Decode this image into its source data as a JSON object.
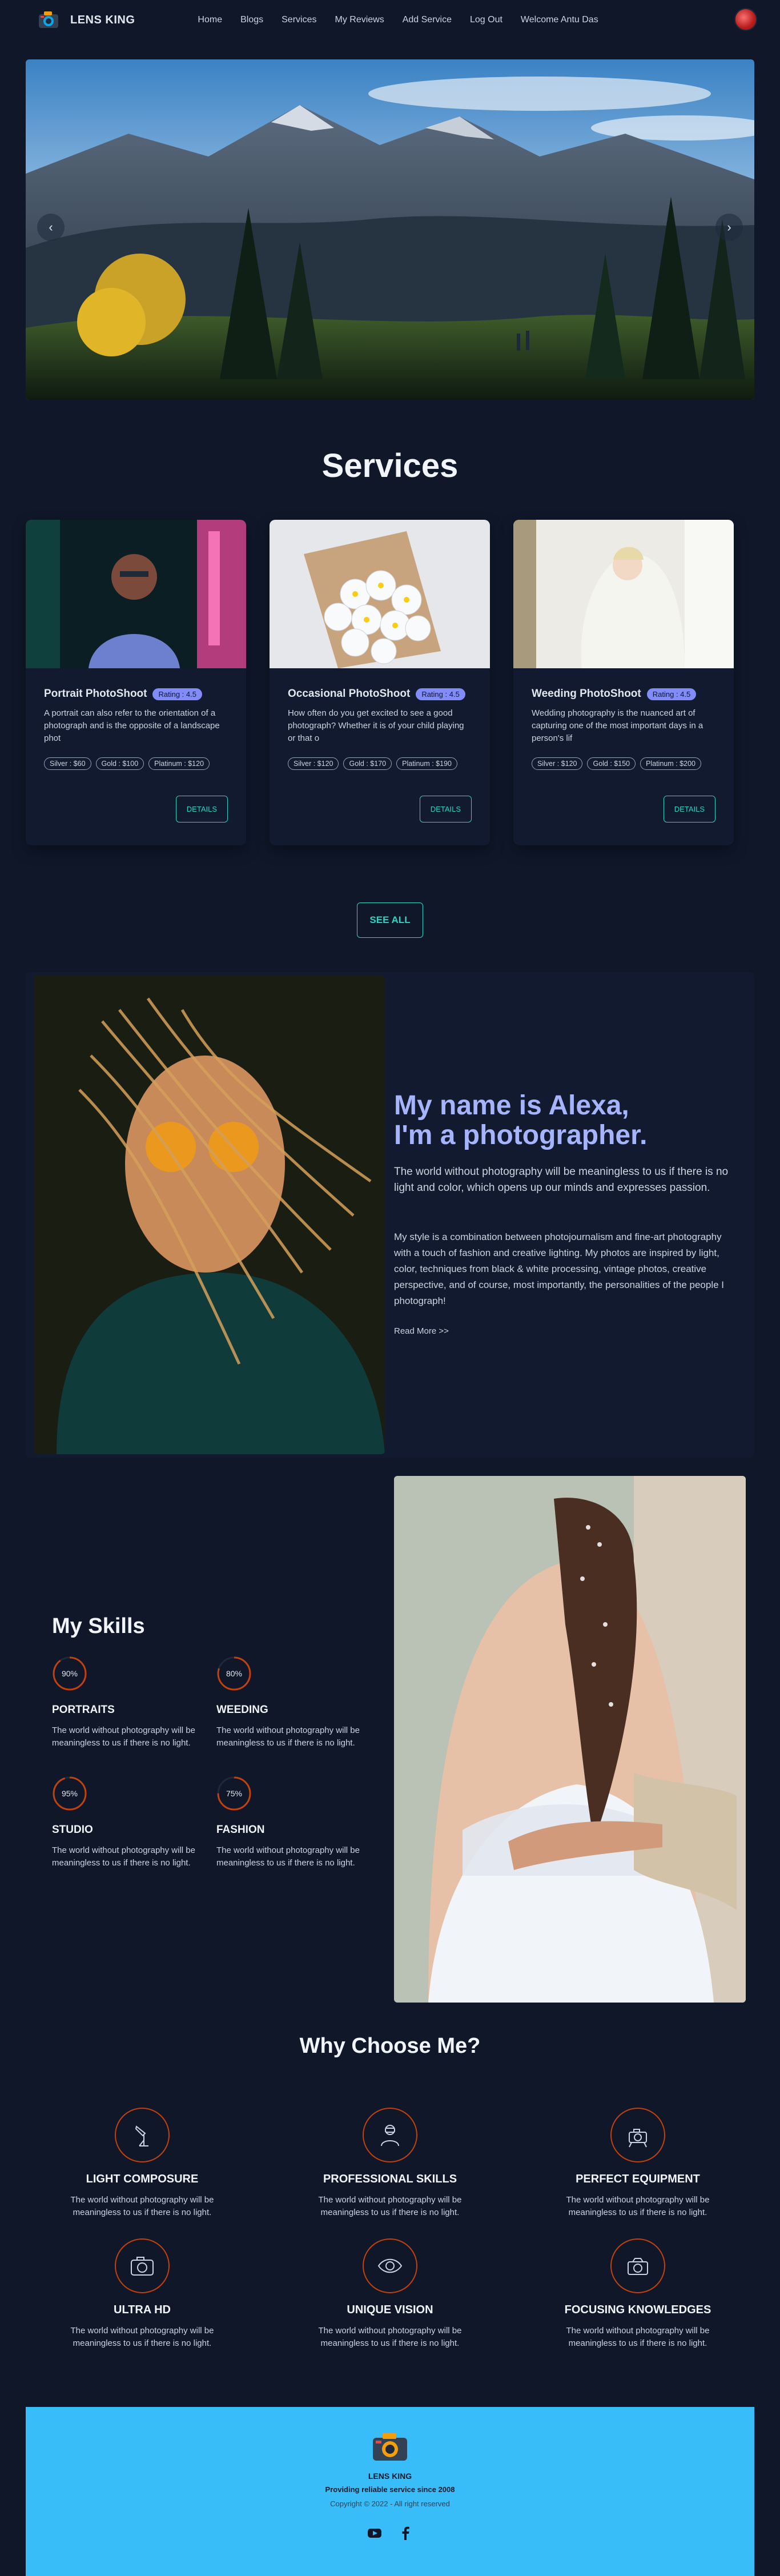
{
  "navbar": {
    "brand": "LENS KING",
    "items": [
      "Home",
      "Blogs",
      "Services",
      "My Reviews",
      "Add Service",
      "Log Out",
      "Welcome Antu Das"
    ]
  },
  "hero": {
    "prev_icon": "chevron-left-icon",
    "next_icon": "chevron-right-icon",
    "prev_label": "‹",
    "next_label": "›"
  },
  "services": {
    "title": "Services",
    "cards": [
      {
        "title": "Portrait PhotoShoot",
        "rating": "Rating : 4.5",
        "description": "A portrait can also refer to the orientation of a photograph and is the opposite of a landscape phot",
        "prices": [
          "Silver : $60",
          "Gold : $100",
          "Platinum : $120"
        ],
        "button": "DETAILS"
      },
      {
        "title": "Occasional PhotoShoot",
        "rating": "Rating : 4.5",
        "description": "How often do you get excited to see a good photograph? Whether it is of your child playing or that o",
        "prices": [
          "Silver : $120",
          "Gold : $170",
          "Platinum : $190"
        ],
        "button": "DETAILS"
      },
      {
        "title": "Weeding PhotoShoot",
        "rating": "Rating : 4.5",
        "description": "Wedding photography is the nuanced art of capturing one of the most important days in a person's lif",
        "prices": [
          "Silver : $120",
          "Gold : $150",
          "Platinum : $200"
        ],
        "button": "DETAILS"
      }
    ],
    "see_all": "SEE ALL"
  },
  "about": {
    "heading_line1": "My name is Alexa,",
    "heading_line2": "I'm a photographer.",
    "intro": "The world without photography will be meaningless to us if there is no light and color, which opens up our minds and expresses passion.",
    "body": "My style is a combination between photojournalism and fine-art photography with a touch of fashion and creative lighting. My photos are inspired by light, color, techniques from black & white processing, vintage photos, creative perspective, and of course, most importantly, the personalities of the people I photograph!",
    "read_more": "Read More >>"
  },
  "skills": {
    "title": "My Skills",
    "items": [
      {
        "percent": 90,
        "label": "90%",
        "name": "PORTRAITS",
        "desc": "The world without photography will be meaningless to us if there is no light."
      },
      {
        "percent": 80,
        "label": "80%",
        "name": "WEEDING",
        "desc": "The world without photography will be meaningless to us if there is no light."
      },
      {
        "percent": 95,
        "label": "95%",
        "name": "STUDIO",
        "desc": "The world without photography will be meaningless to us if there is no light."
      },
      {
        "percent": 75,
        "label": "75%",
        "name": "FASHION",
        "desc": "The world without photography will be meaningless to us if there is no light."
      }
    ]
  },
  "why": {
    "title": "Why Choose Me?",
    "items": [
      {
        "icon": "light-icon",
        "name": "LIGHT COMPOSURE",
        "desc": "The world without photography will be meaningless to us if there is no light."
      },
      {
        "icon": "photographer-icon",
        "name": "PROFESSIONAL SKILLS",
        "desc": "The world without photography will be meaningless to us if there is no light."
      },
      {
        "icon": "camera-equipment-icon",
        "name": "PERFECT EQUIPMENT",
        "desc": "The world without photography will be meaningless to us if there is no light."
      },
      {
        "icon": "camera-hd-icon",
        "name": "ULTRA HD",
        "desc": "The world without photography will be meaningless to us if there is no light."
      },
      {
        "icon": "eye-icon",
        "name": "UNIQUE VISION",
        "desc": "The world without photography will be meaningless to us if there is no light."
      },
      {
        "icon": "lens-icon",
        "name": "FOCUSING KNOWLEDGES",
        "desc": "The world without photography will be meaningless to us if there is no light."
      }
    ]
  },
  "footer": {
    "name": "LENS KING",
    "tagline": "Providing reliable service since 2008",
    "copyright": "Copyright © 2022 - All right reserved",
    "social": [
      "youtube-icon",
      "facebook-icon"
    ]
  },
  "colors": {
    "background": "#0f1729",
    "accent_teal": "#2dd4bf",
    "accent_indigo": "#a5b4fc",
    "badge": "#818cf8",
    "footer": "#38bdf8",
    "icon_ring": "#c2410c"
  }
}
